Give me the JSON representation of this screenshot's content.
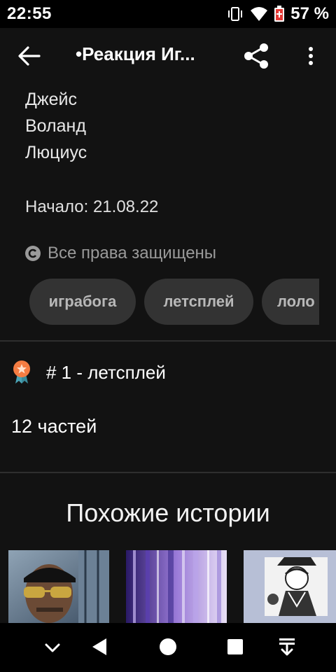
{
  "status": {
    "time": "22:55",
    "battery": "57 %"
  },
  "app_bar": {
    "title": "•Реакция Иг..."
  },
  "characters": [
    "Джейс",
    "Воланд",
    "Люциус"
  ],
  "start": "Начало: 21.08.22",
  "rights": "Все права защищены",
  "tags": [
    "играбога",
    "летсплей",
    "лоло"
  ],
  "rank": "# 1 - летсплей",
  "parts": "12 частей",
  "similar": {
    "title": "Похожие истории"
  },
  "colors": {
    "background": "#121212",
    "tag_bg": "#333333",
    "badge_orange": "#f47c42",
    "badge_teal": "#4aa3b5"
  }
}
